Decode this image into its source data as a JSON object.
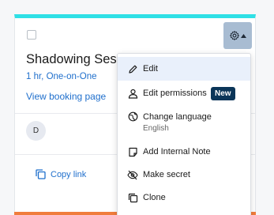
{
  "card": {
    "title": "Shadowing Session",
    "subtitle": "1 hr, One-on-One",
    "booking_link": "View booking page",
    "avatar_initial": "D",
    "copy_link": "Copy link",
    "accent_color": "#2fe0e6"
  },
  "menu": {
    "items": [
      {
        "label": "Edit",
        "icon": "pencil-icon"
      },
      {
        "label": "Edit permissions",
        "icon": "person-icon",
        "badge": "New"
      },
      {
        "label": "Change language",
        "icon": "language-icon",
        "sublabel": "English"
      },
      {
        "label": "Add Internal Note",
        "icon": "note-icon"
      },
      {
        "label": "Make secret",
        "icon": "eye-slash-icon"
      },
      {
        "label": "Clone",
        "icon": "clone-icon"
      }
    ]
  },
  "colors": {
    "link": "#1f6fcc",
    "badge_bg": "#0b3558",
    "highlight": "#e9f0fb",
    "next_card_accent": "#f07d3c"
  }
}
